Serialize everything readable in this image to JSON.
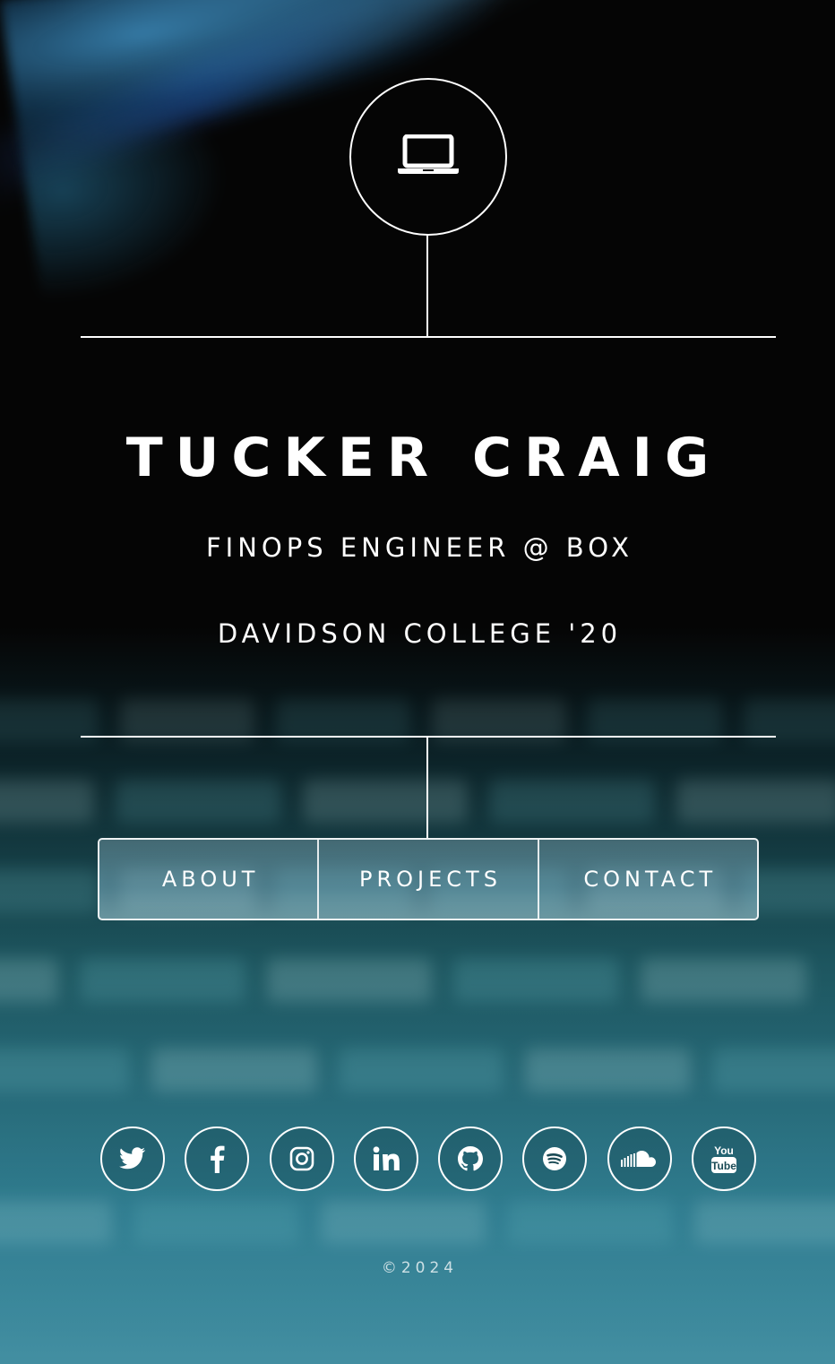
{
  "header": {
    "logo_icon": "laptop-icon",
    "name": "TUCKER CRAIG",
    "role": "FINOPS ENGINEER @ BOX",
    "education": "DAVIDSON COLLEGE '20"
  },
  "nav": {
    "items": [
      {
        "label": "ABOUT"
      },
      {
        "label": "PROJECTS"
      },
      {
        "label": "CONTACT"
      }
    ]
  },
  "socials": [
    {
      "icon": "twitter-icon"
    },
    {
      "icon": "facebook-icon"
    },
    {
      "icon": "instagram-icon"
    },
    {
      "icon": "linkedin-icon"
    },
    {
      "icon": "github-icon"
    },
    {
      "icon": "spotify-icon"
    },
    {
      "icon": "soundcloud-icon"
    },
    {
      "icon": "youtube-icon"
    }
  ],
  "footer": {
    "copyright": "©2024"
  },
  "colors": {
    "text": "#ffffff",
    "background_top": "#040404",
    "background_bottom": "#4a96a8"
  }
}
